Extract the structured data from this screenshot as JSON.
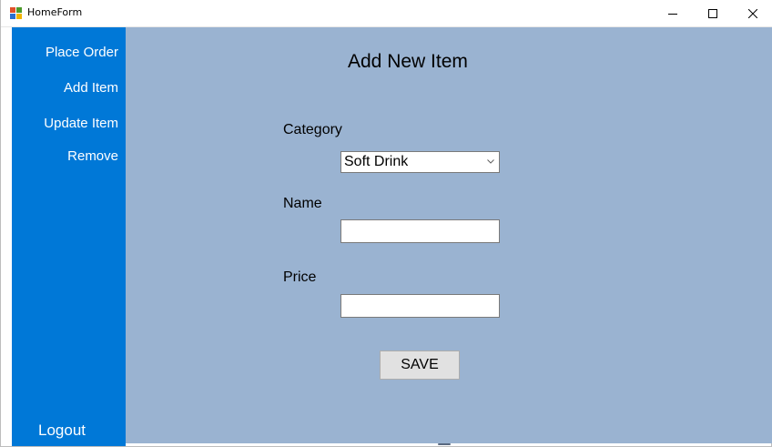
{
  "window": {
    "title": "HomeForm",
    "colors": {
      "sidebar": "#0078d7",
      "content": "#9ab3d1",
      "titlebar": "#ffffff"
    }
  },
  "caption_buttons": {
    "minimize_icon": "minimize-icon",
    "maximize_icon": "maximize-icon",
    "close_icon": "close-icon"
  },
  "sidebar": {
    "items": [
      {
        "label": "Place Order"
      },
      {
        "label": "Add Item"
      },
      {
        "label": "Update Item"
      },
      {
        "label": "Remove"
      }
    ],
    "logout_label": "Logout"
  },
  "form": {
    "heading": "Add New Item",
    "category_label": "Category",
    "category_value": "Soft Drink",
    "name_label": "Name",
    "name_value": "",
    "price_label": "Price",
    "price_value": "",
    "save_label": "SAVE"
  }
}
